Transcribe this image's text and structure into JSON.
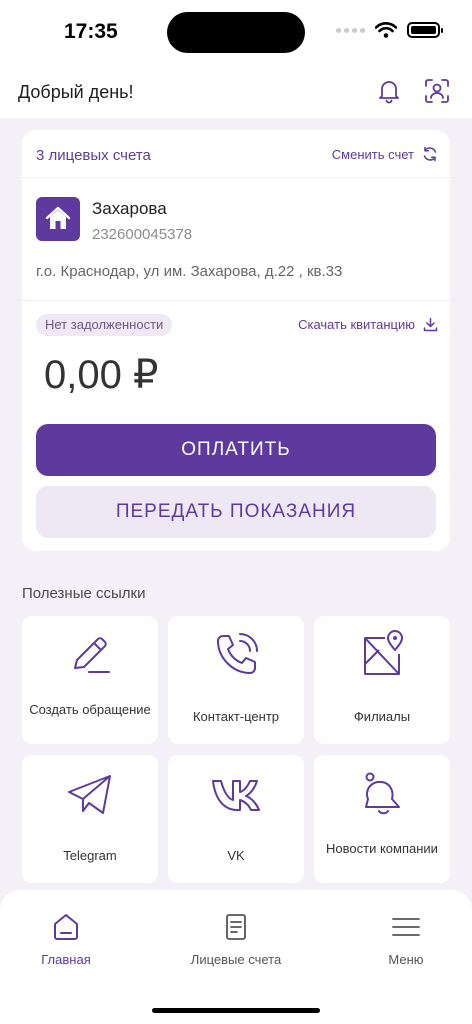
{
  "status_bar": {
    "time": "17:35"
  },
  "header": {
    "greeting": "Добрый день!"
  },
  "account_card": {
    "accounts_count": "3 лицевых счета",
    "switch_label": "Сменить счет",
    "owner_name": "Захарова",
    "account_number": "232600045378",
    "address": "г.о. Краснодар, ул им. Захарова, д.22 , кв.33",
    "debt_status": "Нет задолженности",
    "download_label": "Скачать квитанцию",
    "balance": "0,00 ₽",
    "pay_label": "ОПЛАТИТЬ",
    "meter_label": "ПЕРЕДАТЬ ПОКАЗАНИЯ"
  },
  "useful_links": {
    "title": "Полезные ссылки",
    "items": [
      {
        "label": "Создать обращение",
        "icon": "pencil-icon"
      },
      {
        "label": "Контакт-центр",
        "icon": "phone-icon"
      },
      {
        "label": "Филиалы",
        "icon": "map-pin-icon"
      },
      {
        "label": "Telegram",
        "icon": "telegram-icon"
      },
      {
        "label": "VK",
        "icon": "vk-icon"
      },
      {
        "label": "Новости компании",
        "icon": "bell-icon"
      }
    ]
  },
  "bottom_nav": {
    "items": [
      {
        "label": "Главная",
        "icon": "home-icon",
        "active": true
      },
      {
        "label": "Лицевые счета",
        "icon": "document-icon"
      },
      {
        "label": "Меню",
        "icon": "menu-icon"
      }
    ]
  },
  "colors": {
    "accent": "#5e3a9e",
    "background": "#f3f0f7",
    "secondary_button": "#ede8f3"
  }
}
